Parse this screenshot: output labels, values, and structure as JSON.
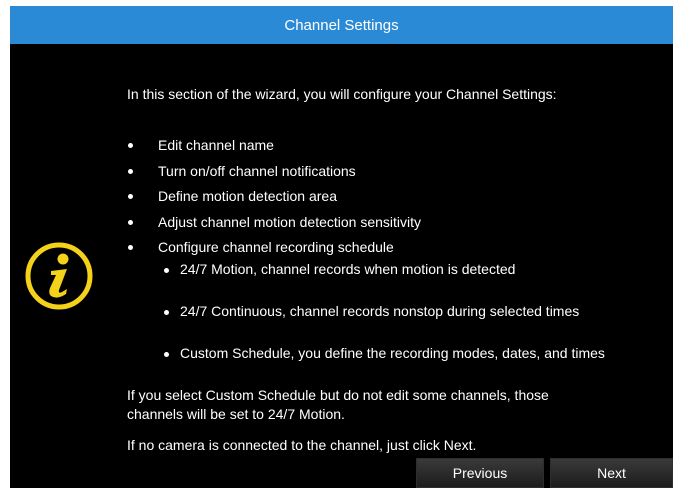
{
  "window": {
    "title": "Channel Settings"
  },
  "intro": "In this section of the wizard, you will configure your Channel Settings:",
  "bullets": [
    "Edit channel name",
    "Turn on/off channel notifications",
    "Define motion detection area",
    "Adjust channel motion detection sensitivity",
    "Configure channel recording schedule"
  ],
  "sub_bullets": [
    "24/7 Motion, channel records when motion is detected",
    "24/7 Continuous, channel records nonstop during selected times",
    "Custom Schedule, you define the recording modes, dates, and times"
  ],
  "note_custom": {
    "line1": "If you select Custom Schedule but do not edit some channels, those",
    "line2": "channels will be set to 24/7 Motion."
  },
  "note_no_camera": "If no camera is connected to the channel, just click Next.",
  "buttons": {
    "previous": "Previous",
    "next": "Next"
  },
  "icons": {
    "info": "info-icon"
  },
  "colors": {
    "title_bar": "#2b8ad6",
    "background": "#000000",
    "icon": "#f5d21a"
  }
}
